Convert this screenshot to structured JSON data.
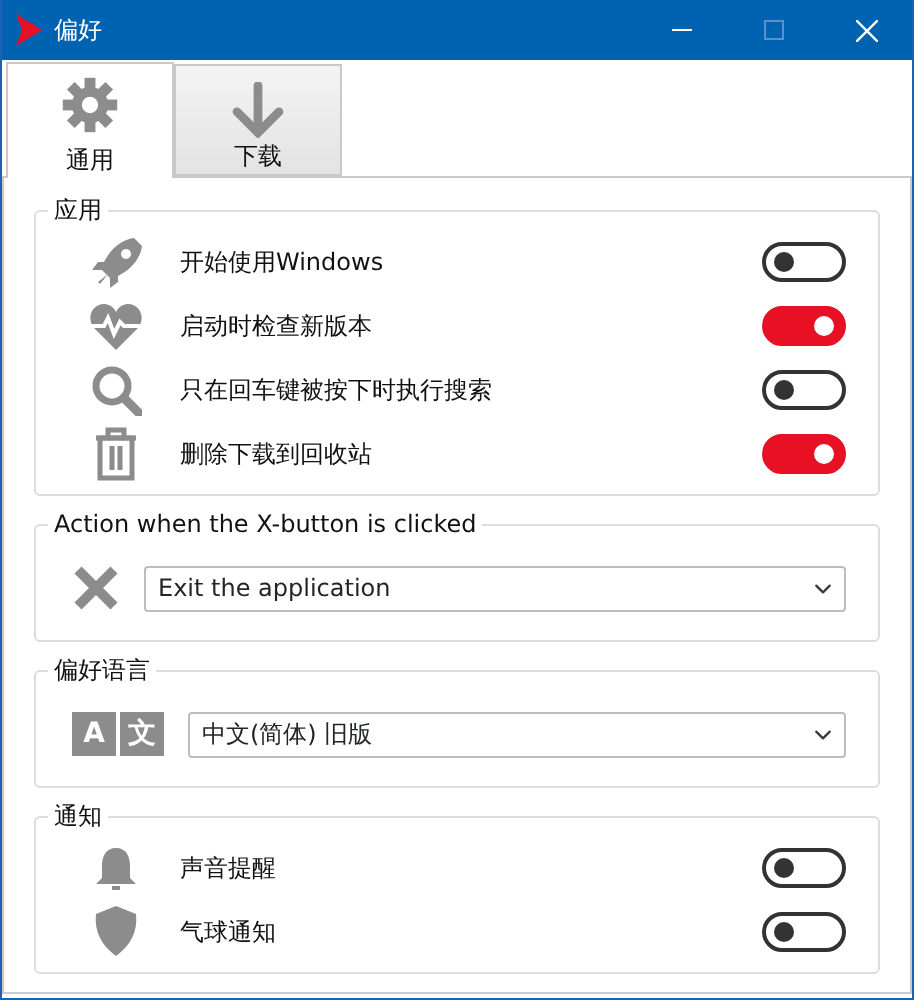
{
  "window": {
    "title": "偏好"
  },
  "tabs": [
    {
      "label": "通用",
      "selected": true
    },
    {
      "label": "下载",
      "selected": false
    }
  ],
  "sections": [
    {
      "title": "应用",
      "kind": "toggles",
      "rows": [
        {
          "label": "开始使用Windows",
          "on": false
        },
        {
          "label": "启动时检查新版本",
          "on": true
        },
        {
          "label": "只在回车键被按下时执行搜索",
          "on": false
        },
        {
          "label": "删除下载到回收站",
          "on": true
        }
      ]
    },
    {
      "title": "Action when the X-button is clicked",
      "kind": "dropdown",
      "value": "Exit the application"
    },
    {
      "title": "偏好语言",
      "kind": "dropdown",
      "value": "中文(简体) 旧版",
      "icon_letters": [
        "A",
        "文"
      ]
    },
    {
      "title": "通知",
      "kind": "toggles",
      "rows": [
        {
          "label": "声音提醒",
          "on": false
        },
        {
          "label": "气球通知",
          "on": false
        }
      ]
    }
  ]
}
